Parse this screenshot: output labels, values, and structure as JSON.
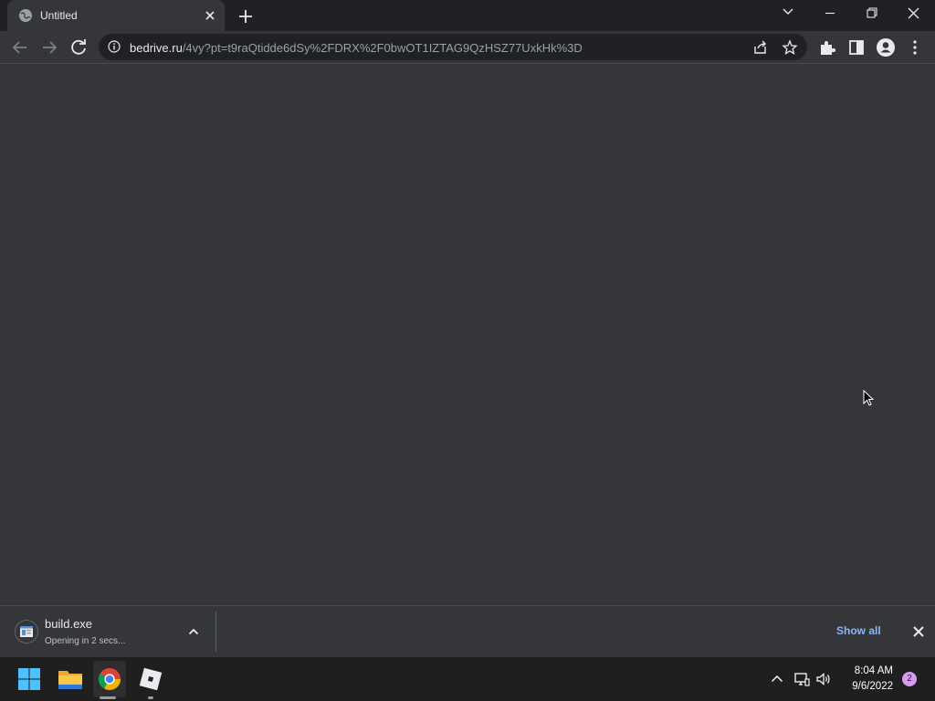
{
  "browser": {
    "tab": {
      "title": "Untitled",
      "favicon": "globe-icon"
    },
    "url": {
      "host": "bedrive.ru",
      "path": "/4vy?pt=t9raQtidde6dSy%2FDRX%2F0bwOT1IZTAG9QzHSZ77UxkHk%3D"
    }
  },
  "download": {
    "filename": "build.exe",
    "status": "Opening in 2 secs...",
    "show_all_label": "Show all"
  },
  "taskbar": {
    "time": "8:04 AM",
    "date": "9/6/2022",
    "notification_count": "2"
  },
  "colors": {
    "page_background": "#35363a",
    "tabstrip_background": "#202124",
    "taskbar_background": "#1f1f1f",
    "link_accent": "#8ab4f8",
    "notification_badge": "#d59cf0"
  }
}
